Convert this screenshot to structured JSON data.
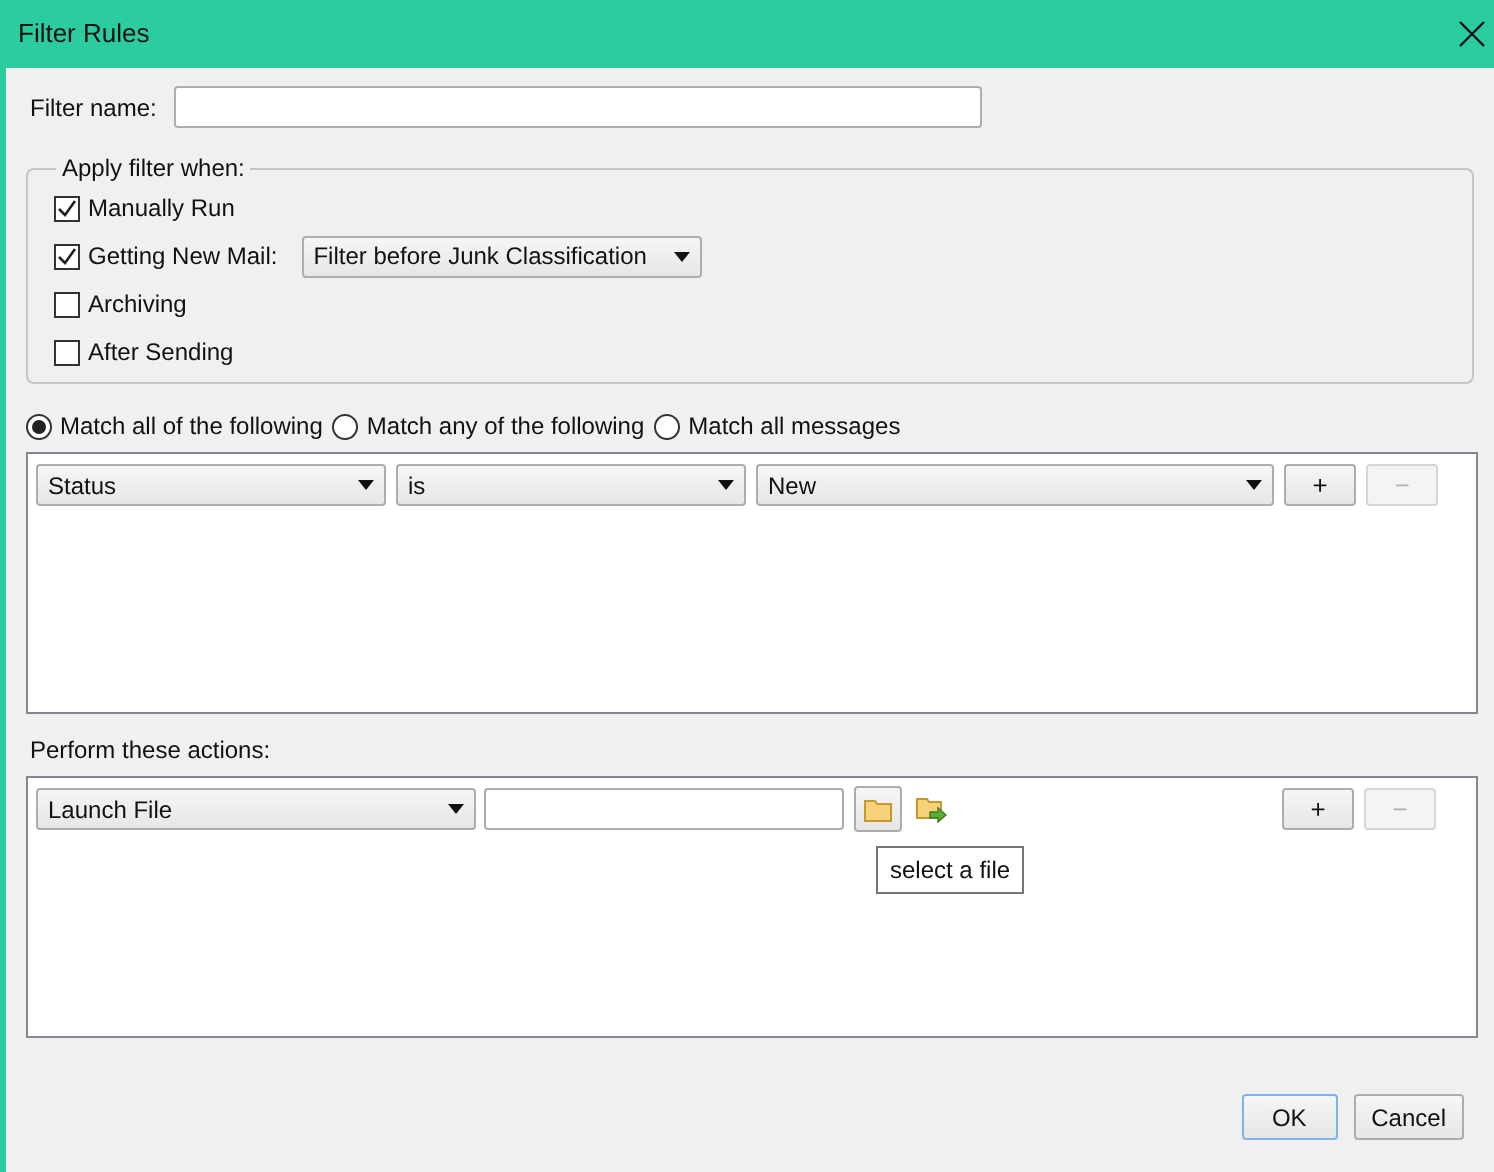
{
  "window": {
    "title": "Filter Rules"
  },
  "filter_name": {
    "label": "Filter name:"
  },
  "apply_group": {
    "legend": "Apply filter when:",
    "options": [
      {
        "kind": "checkbox",
        "label": "Manually Run",
        "checked": true
      },
      {
        "kind": "checkbox-select",
        "label": "Getting New Mail:",
        "checked": true,
        "select": "Filter before Junk Classification"
      },
      {
        "kind": "checkbox",
        "label": "Archiving",
        "checked": false
      },
      {
        "kind": "checkbox",
        "label": "After Sending",
        "checked": false
      }
    ]
  },
  "match": [
    {
      "label": "Match all of the following",
      "selected": true
    },
    {
      "label": "Match any of the following",
      "selected": false
    },
    {
      "label": "Match all messages",
      "selected": false
    }
  ],
  "conditions": [
    {
      "field": "Status",
      "operator": "is",
      "value": "New",
      "add": "+",
      "remove": "−",
      "remove_disabled": true
    }
  ],
  "actions": {
    "label": "Perform these actions:",
    "rows": [
      {
        "action": "Launch File",
        "tooltip": "select a file",
        "add": "+",
        "remove": "−",
        "remove_disabled": true
      }
    ]
  },
  "buttons": [
    "OK",
    "Cancel"
  ]
}
